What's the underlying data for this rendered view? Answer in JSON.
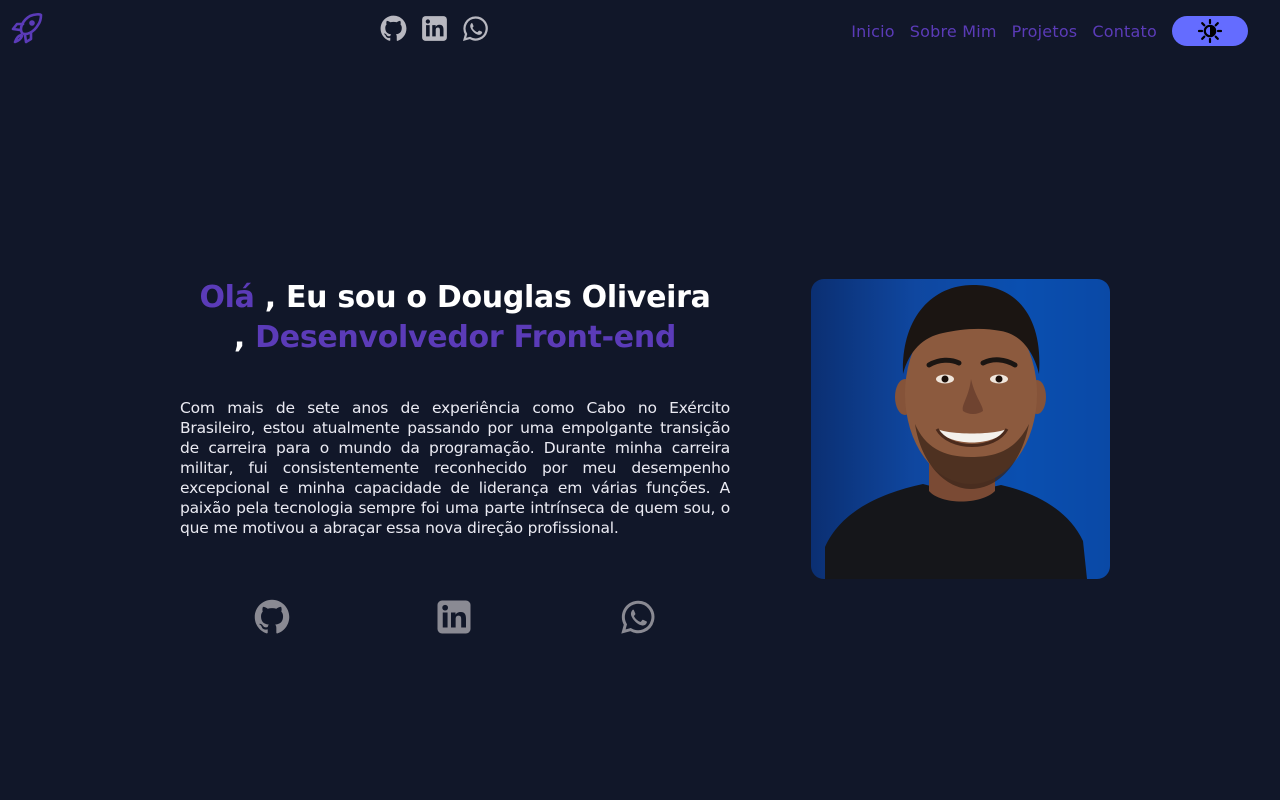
{
  "colors": {
    "background": "#111729",
    "accent": "#5b3bb8",
    "toggle": "#646cff",
    "icon_gray": "#b8b8c0",
    "icon_dark_gray": "#8a8a93"
  },
  "header": {
    "logo_icon": "rocket-icon",
    "social_icons": [
      "github-icon",
      "linkedin-icon",
      "whatsapp-icon"
    ],
    "nav": [
      {
        "label": "Inicio"
      },
      {
        "label": "Sobre Mim"
      },
      {
        "label": "Projetos"
      },
      {
        "label": "Contato"
      }
    ],
    "theme_toggle_icon": "sun-icon"
  },
  "hero": {
    "greeting": "Olá",
    "intro": " , Eu sou o Douglas Oliveira",
    "comma": ", ",
    "role": "Desenvolvedor Front-end",
    "bio": "Com mais de sete anos de experiência como Cabo no Exército Brasileiro, estou atualmente passando por uma empolgante transição de carreira para o mundo da programação. Durante minha carreira militar, fui consistentemente reconhecido por meu desempenho excepcional e minha capacidade de liderança em várias funções. A paixão pela tecnologia sempre foi uma parte intrínseca de quem sou, o que me motivou a abraçar essa nova direção profissional.",
    "social_icons": [
      "github-icon",
      "linkedin-icon",
      "whatsapp-icon"
    ],
    "photo_icon": "profile-photo"
  }
}
